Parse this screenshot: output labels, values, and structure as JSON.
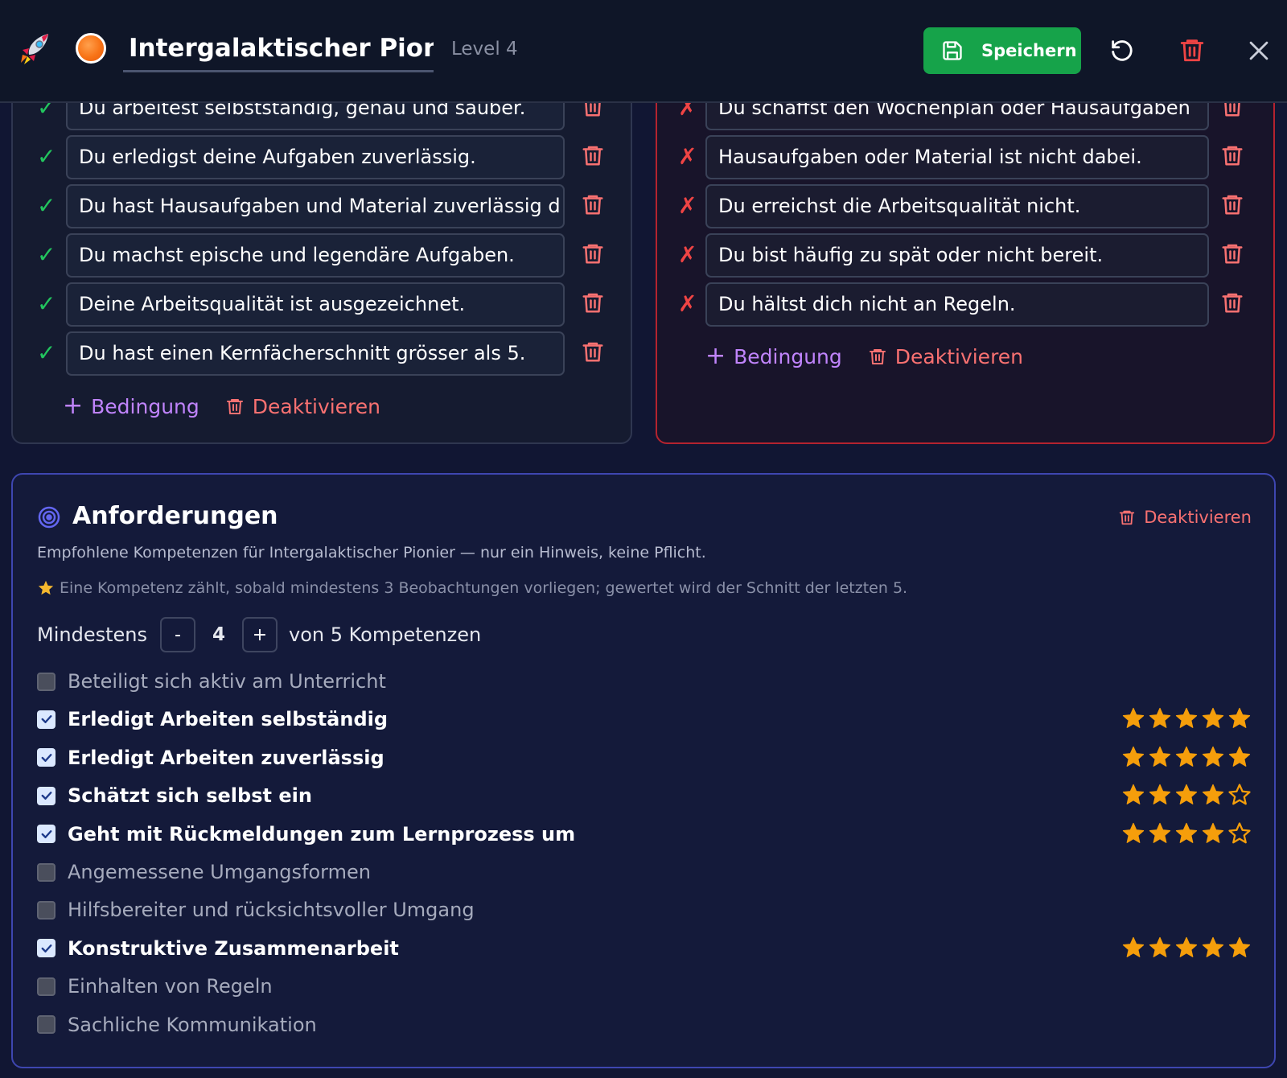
{
  "header": {
    "title": "Intergalaktischer Pioni",
    "level": "Level 4",
    "save_label": "Speichern",
    "icons": [
      "rocket-icon",
      "undo-icon",
      "trash-icon",
      "close-icon"
    ]
  },
  "colors": {
    "accent_green": "#16a34a",
    "check_green": "#22c55e",
    "danger_red": "#ef4444",
    "purple_link": "#c084fc",
    "star_gold": "#f59e0b",
    "req_border": "#3e46b0"
  },
  "success_conditions": {
    "items": [
      "Du arbeitest selbstständig, genau und sauber.",
      "Du erledigst deine Aufgaben zuverlässig.",
      "Du hast Hausaufgaben und Material zuverlässig d",
      "Du machst epische und legendäre Aufgaben.",
      "Deine Arbeitsqualität ist ausgezeichnet.",
      "Du hast einen Kernfächerschnitt grösser als 5."
    ],
    "mark": "✓",
    "add_label": "Bedingung",
    "deactivate_label": "Deaktivieren"
  },
  "fail_conditions": {
    "items": [
      "Du schaffst den Wochenplan oder Hausaufgaben",
      "Hausaufgaben oder Material ist nicht dabei.",
      "Du erreichst die Arbeitsqualität nicht.",
      "Du bist häufig zu spät oder nicht bereit.",
      "Du hältst dich nicht an Regeln."
    ],
    "mark": "✗",
    "add_label": "Bedingung",
    "deactivate_label": "Deaktivieren"
  },
  "requirements": {
    "title": "Anforderungen",
    "deactivate_label": "Deaktivieren",
    "subtitle": "Empfohlene Kompetenzen für Intergalaktischer Pionier — nur ein Hinweis, keine Pflicht.",
    "hint": "Eine Kompetenz zählt, sobald mindestens 3 Beobachtungen vorliegen; gewertet wird der Schnitt der letzten 5.",
    "min_label": "Mindestens",
    "minus_label": "-",
    "min_value": "4",
    "plus_label": "+",
    "min_suffix": "von 5 Kompetenzen",
    "competencies": [
      {
        "label": "Beteiligt sich aktiv am Unterricht",
        "checked": false,
        "stars": 0
      },
      {
        "label": "Erledigt Arbeiten selbständig",
        "checked": true,
        "stars": 5
      },
      {
        "label": "Erledigt Arbeiten zuverlässig",
        "checked": true,
        "stars": 5
      },
      {
        "label": "Schätzt sich selbst ein",
        "checked": true,
        "stars": 4
      },
      {
        "label": "Geht mit Rückmeldungen zum Lernprozess um",
        "checked": true,
        "stars": 4
      },
      {
        "label": "Angemessene Umgangsformen",
        "checked": false,
        "stars": 0
      },
      {
        "label": "Hilfsbereiter und rücksichtsvoller Umgang",
        "checked": false,
        "stars": 0
      },
      {
        "label": "Konstruktive Zusammenarbeit",
        "checked": true,
        "stars": 5
      },
      {
        "label": "Einhalten von Regeln",
        "checked": false,
        "stars": 0
      },
      {
        "label": "Sachliche Kommunikation",
        "checked": false,
        "stars": 0
      }
    ]
  }
}
